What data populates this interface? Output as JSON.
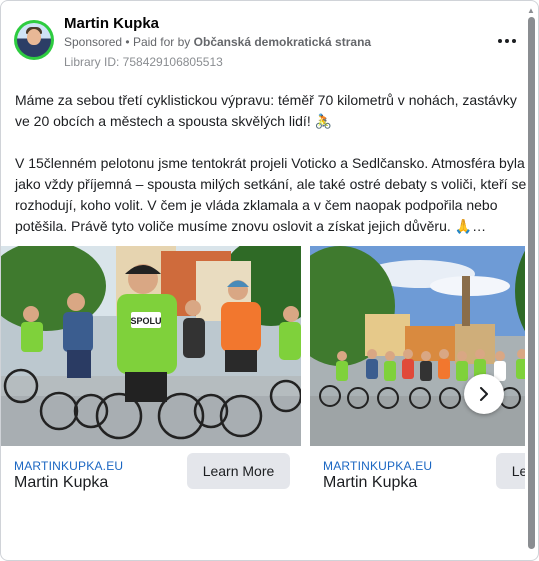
{
  "post": {
    "author": "Martin Kupka",
    "sponsored": "Sponsored",
    "separator": "•",
    "paid_for_prefix": "Paid for by",
    "paid_for_by": "Občanská demokratická strana",
    "library_id": "Library ID: 758429106805513",
    "paragraph_1": "Máme za sebou třetí cyklistickou výpravu: téměř 70 kilometrů v nohách, zastávky ve 20 obcích a městech a spousta skvělých lidí! 🚴",
    "paragraph_2": "V 15členném pelotonu jsme tentokrát projeli Voticko a Sedlčansko. Atmosféra byla jako vždy příjemná – spousta milých setkání, ale také ostré debaty s voliči, kteří se rozhodují, koho volit. V čem je vláda zklamala a v čem naopak podpořila nebo potěšila. Právě tyto voliče musíme znovu oslovit a získat jejich důvěru. 🙏…"
  },
  "carousel": [
    {
      "domain": "MARTINKUPKA.EU",
      "title": "Martin Kupka",
      "button_label": "Learn More",
      "shirt_text": "SPOLU"
    },
    {
      "domain": "MARTINKUPKA.EU",
      "title": "Martin Kupka",
      "button_label": "Learn More"
    }
  ],
  "icons": {
    "more": "more-horizontal-icon",
    "next": "chevron-right-icon",
    "scroll_up": "▲",
    "scroll_down": "▼"
  },
  "colors": {
    "avatar_ring": "#2ecc40",
    "link_domain": "#1a66c2",
    "button_bg": "#e4e6eb",
    "shirt_green": "#7fd13b"
  }
}
